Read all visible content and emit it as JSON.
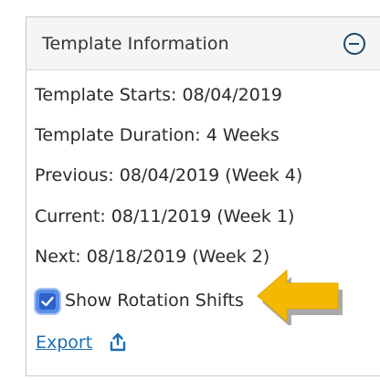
{
  "panel": {
    "title": "Template Information",
    "collapse_icon": "minus-circle-icon"
  },
  "info": {
    "template_starts": "Template Starts: 08/04/2019",
    "template_duration": "Template Duration: 4 Weeks",
    "previous": "Previous: 08/04/2019 (Week 4)",
    "current": "Current: 08/11/2019 (Week 1)",
    "next": "Next: 08/18/2019 (Week 2)"
  },
  "show_rotation_shifts": {
    "label": "Show Rotation Shifts",
    "checked": true
  },
  "export": {
    "label": "Export",
    "icon": "share-upload-icon"
  },
  "annotation": {
    "icon": "pointer-arrow-icon",
    "color": "#f5b800"
  }
}
